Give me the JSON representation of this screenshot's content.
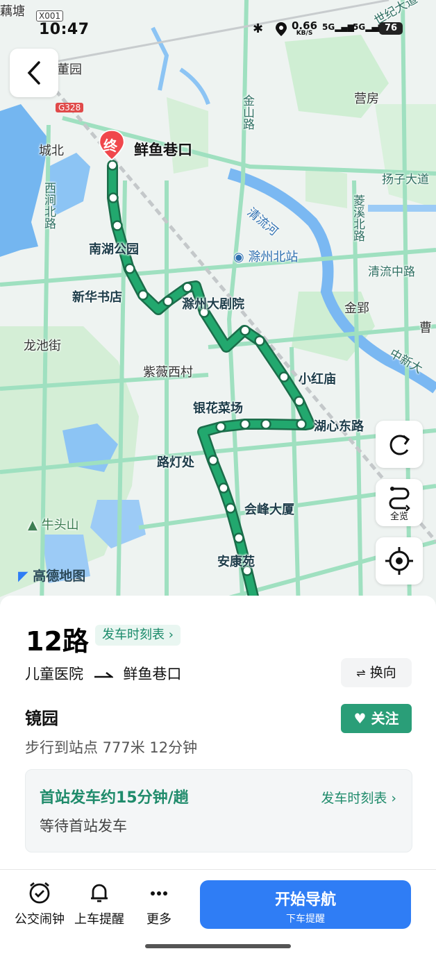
{
  "status_bar": {
    "time": "10:47",
    "carrier_tag": "X001",
    "net_rate": "0.66",
    "net_unit": "KB/S",
    "signal_1": "5G",
    "signal_2": "5G",
    "battery": "76"
  },
  "map": {
    "labels": {
      "outhang": "藕塘",
      "dongyuan": "董园",
      "g328": "G328",
      "chengbei": "城北",
      "xihu_road": "西涧北路",
      "jinshan_road": "金山路",
      "yingfang": "营房",
      "yangzi_road": "扬子大道",
      "shiji_road": "世纪大道",
      "qingliu_river": "清流河",
      "lingxi_road": "菱溪北路",
      "chuzhou_north": "滁州北站",
      "qingliu_mid_road": "清流中路",
      "jinying": "金郢",
      "cao": "曹",
      "zhongxin_road": "中新大",
      "longchi": "龙池街",
      "ziwei": "紫薇西村",
      "niutou": "牛头山"
    },
    "stops": {
      "nanhu": "南湖公园",
      "xinhua": "新华书店",
      "theater": "滁州大剧院",
      "xiaohongmiao": "小红庙",
      "huxin": "湖心东路",
      "yinhua": "银花菜场",
      "ludeng": "路灯处",
      "huifeng": "会峰大厦",
      "ankang": "安康苑"
    },
    "destination": "鲜鱼巷口",
    "destination_badge": "终",
    "brand": "高德地图",
    "overview_label": "全览",
    "route_color": "#1e9e6a"
  },
  "panel": {
    "route_name": "12路",
    "timetable_chip": "发车时刻表 ›",
    "from_stop": "儿童医院",
    "to_stop": "鲜鱼巷口",
    "switch_label": "换向",
    "current_stop": "镜园",
    "walk_info": "步行到站点 777米 12分钟",
    "follow_label": "关注",
    "frequency": "首站发车约15分钟/趟",
    "timetable_link": "发车时刻表 ›",
    "wait_status": "等待首站发车"
  },
  "toolbar": {
    "alarm": "公交闹钟",
    "remind": "上车提醒",
    "more": "更多",
    "nav_main": "开始导航",
    "nav_sub": "下车提醒"
  }
}
